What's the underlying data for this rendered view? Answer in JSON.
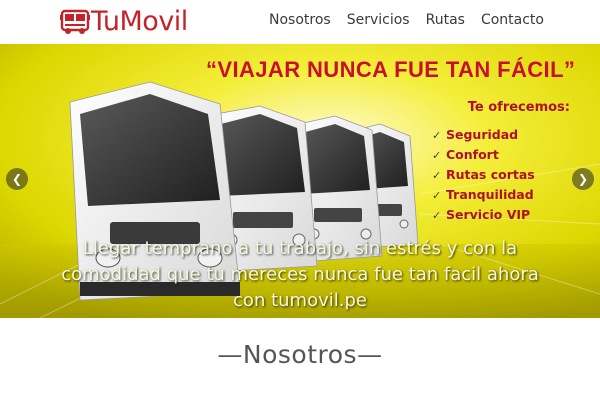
{
  "brand": {
    "name": "TuMovil",
    "accent_color": "#c3242a",
    "logo_icon": "bus-icon"
  },
  "nav": {
    "items": [
      {
        "label": "Nosotros"
      },
      {
        "label": "Servicios"
      },
      {
        "label": "Rutas"
      },
      {
        "label": "Contacto"
      }
    ]
  },
  "hero": {
    "title": "“VIAJAR NUNCA FUE TAN FÁCIL”",
    "offer_title": "Te ofrecemos:",
    "offers": [
      "Seguridad",
      "Confort",
      "Rutas cortas",
      "Tranquilidad",
      "Servicio VIP"
    ],
    "caption_lines": [
      "Llegar temprano a tu trabajo, sin estrés y con la",
      "comodidad que tu mereces nunca fue tan facil ahora",
      "con tumovil.pe"
    ],
    "prev_icon": "chevron-left-icon",
    "next_icon": "chevron-right-icon",
    "background_color": "#e6e000"
  },
  "section": {
    "heading": "—Nosotros—"
  }
}
